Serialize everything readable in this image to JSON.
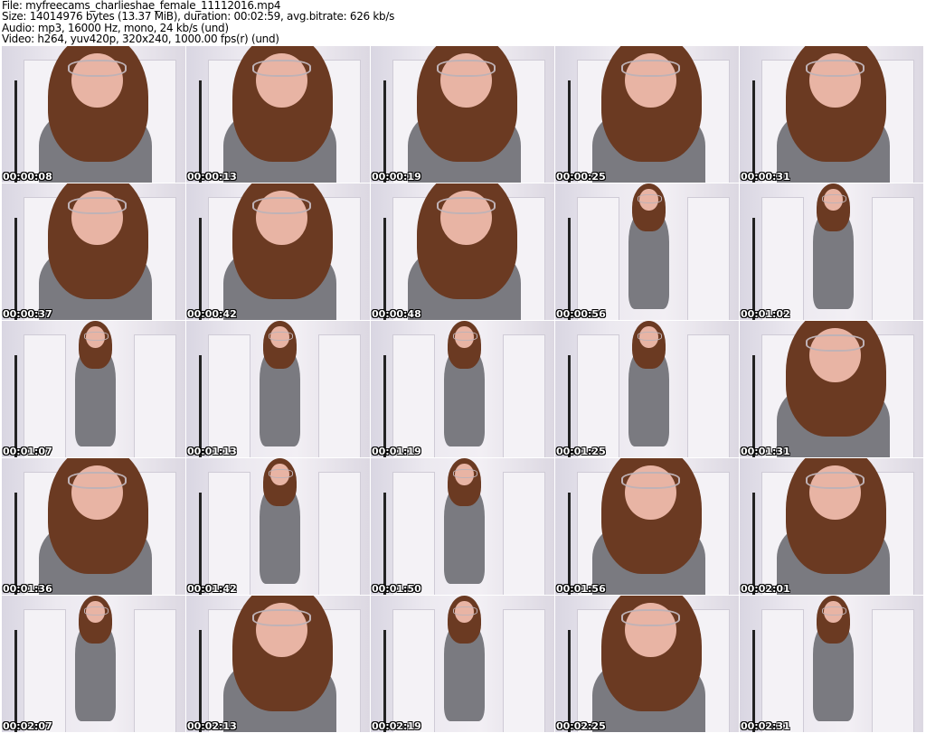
{
  "header": {
    "file": "File: myfreecams_charlieshae_female_11112016.mp4",
    "size": "Size: 14014976 bytes (13.37 MiB), duration: 00:02:59, avg.bitrate: 626 kb/s",
    "audio": "Audio: mp3, 16000 Hz, mono, 24 kb/s (und)",
    "video": "Video: h264, yuv420p, 320x240, 1000.00 fps(r) (und)"
  },
  "thumbnails": [
    {
      "time": "00:00:08",
      "shot": "close"
    },
    {
      "time": "00:00:13",
      "shot": "close"
    },
    {
      "time": "00:00:19",
      "shot": "close"
    },
    {
      "time": "00:00:25",
      "shot": "close"
    },
    {
      "time": "00:00:31",
      "shot": "close"
    },
    {
      "time": "00:00:37",
      "shot": "close"
    },
    {
      "time": "00:00:42",
      "shot": "close"
    },
    {
      "time": "00:00:48",
      "shot": "close"
    },
    {
      "time": "00:00:56",
      "shot": "full"
    },
    {
      "time": "00:01:02",
      "shot": "full"
    },
    {
      "time": "00:01:07",
      "shot": "full"
    },
    {
      "time": "00:01:13",
      "shot": "full"
    },
    {
      "time": "00:01:19",
      "shot": "full"
    },
    {
      "time": "00:01:25",
      "shot": "full"
    },
    {
      "time": "00:01:31",
      "shot": "close"
    },
    {
      "time": "00:01:36",
      "shot": "close"
    },
    {
      "time": "00:01:42",
      "shot": "full"
    },
    {
      "time": "00:01:50",
      "shot": "full"
    },
    {
      "time": "00:01:56",
      "shot": "close"
    },
    {
      "time": "00:02:01",
      "shot": "close"
    },
    {
      "time": "00:02:07",
      "shot": "full"
    },
    {
      "time": "00:02:13",
      "shot": "close"
    },
    {
      "time": "00:02:19",
      "shot": "full"
    },
    {
      "time": "00:02:25",
      "shot": "close"
    },
    {
      "time": "00:02:31",
      "shot": "full"
    }
  ]
}
